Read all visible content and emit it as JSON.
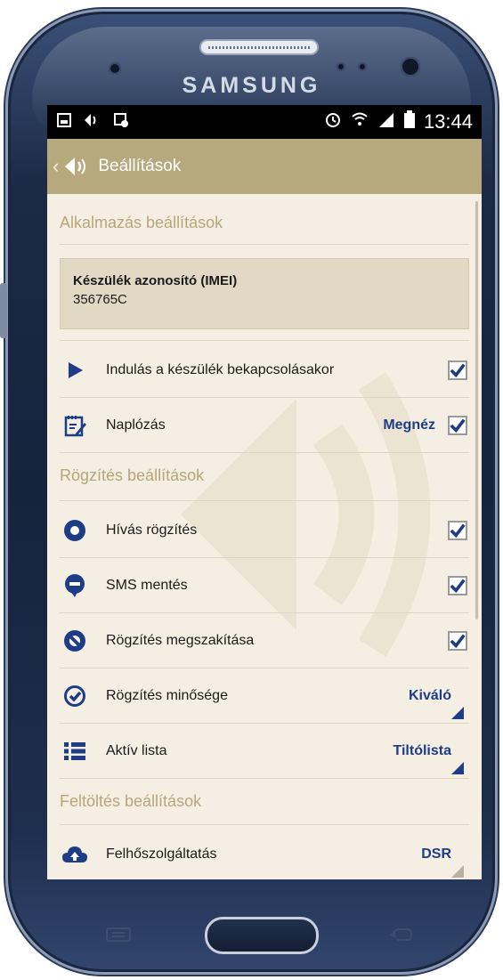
{
  "device": {
    "brand": "SAMSUNG"
  },
  "statusbar": {
    "time": "13:44"
  },
  "actionbar": {
    "title": "Beállítások"
  },
  "sections": {
    "app": "Alkalmazás beállítások",
    "recording": "Rögzítés beállítások",
    "upload": "Feltöltés beállítások"
  },
  "imei": {
    "label": "Készülék azonosító (IMEI)",
    "value": "356765C"
  },
  "rows": {
    "startup": {
      "label": "Indulás a készülék bekapcsolásakor",
      "checked": true,
      "icon": "play-icon"
    },
    "logging": {
      "label": "Naplózás",
      "action": "Megnéz",
      "checked": true,
      "icon": "notepad-icon"
    },
    "call_recording": {
      "label": "Hívás rögzítés",
      "checked": true,
      "icon": "record-circle-icon"
    },
    "sms": {
      "label": "SMS mentés",
      "checked": true,
      "icon": "sms-bubble-icon"
    },
    "interrupt": {
      "label": "Rögzítés megszakítása",
      "checked": true,
      "icon": "interrupt-icon"
    },
    "quality": {
      "label": "Rögzítés minősége",
      "value": "Kiváló",
      "icon": "check-circle-icon"
    },
    "active_list": {
      "label": "Aktív lista",
      "value": "Tiltólista",
      "icon": "list-icon"
    },
    "cloud": {
      "label": "Felhőszolgáltatás",
      "value": "DSR",
      "icon": "cloud-upload-icon"
    }
  },
  "colors": {
    "accent": "#b7a97e",
    "section_text": "#b8a57a",
    "value_text": "#1f3c86",
    "background": "#f4efe2",
    "checkmark": "#1f3c86"
  }
}
